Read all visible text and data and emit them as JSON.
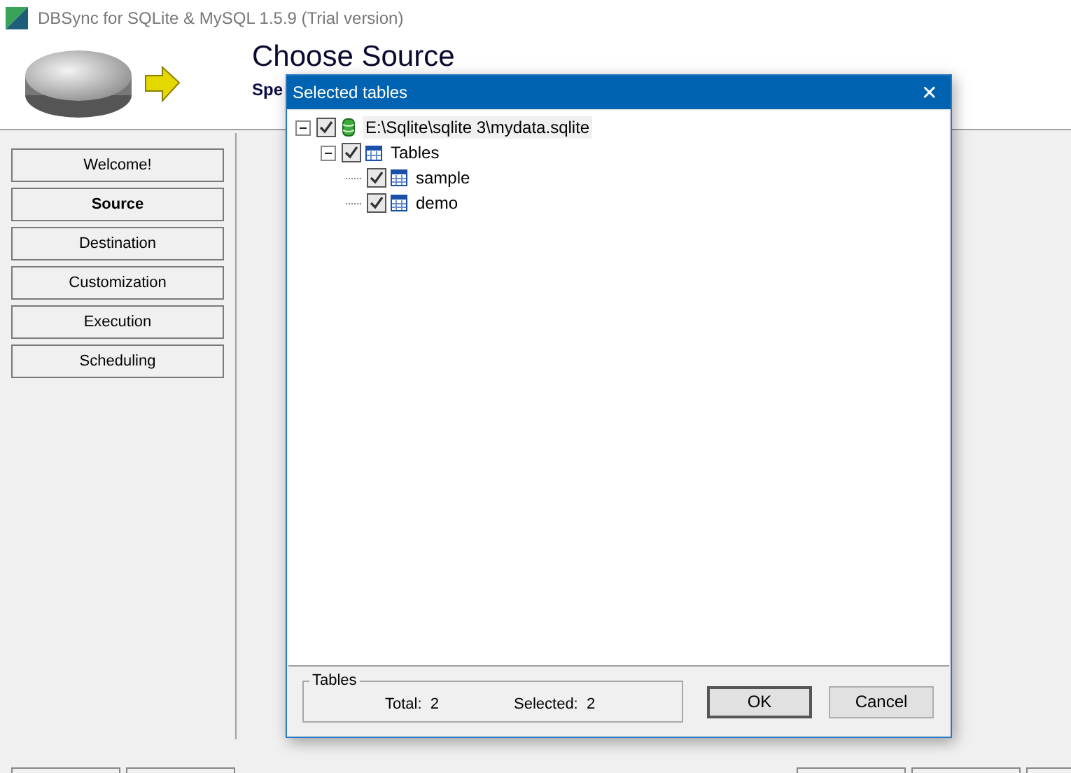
{
  "window": {
    "title": "DBSync for SQLite & MySQL 1.5.9 (Trial version)"
  },
  "header": {
    "title": "Choose Source",
    "subtitle": "Spe"
  },
  "nav": [
    {
      "label": "Welcome!",
      "selected": false
    },
    {
      "label": "Source",
      "selected": true
    },
    {
      "label": "Destination",
      "selected": false
    },
    {
      "label": "Customization",
      "selected": false
    },
    {
      "label": "Execution",
      "selected": false
    },
    {
      "label": "Scheduling",
      "selected": false
    }
  ],
  "dialog": {
    "title": "Selected tables",
    "close": "✕",
    "tree": [
      {
        "kind": "database",
        "label": "E:\\Sqlite\\sqlite 3\\mydata.sqlite",
        "checked": true,
        "expanded": true,
        "selected": true,
        "children": [
          {
            "kind": "folder",
            "label": "Tables",
            "checked": true,
            "expanded": true,
            "selected": false,
            "children": [
              {
                "kind": "table",
                "label": "sample",
                "checked": true,
                "selected": false
              },
              {
                "kind": "table",
                "label": "demo",
                "checked": true,
                "selected": false
              }
            ]
          }
        ]
      }
    ],
    "summary": {
      "label": "Tables",
      "total": "Total:  2",
      "selected": "Selected:  2"
    },
    "buttons": [
      "OK",
      "Cancel"
    ]
  }
}
